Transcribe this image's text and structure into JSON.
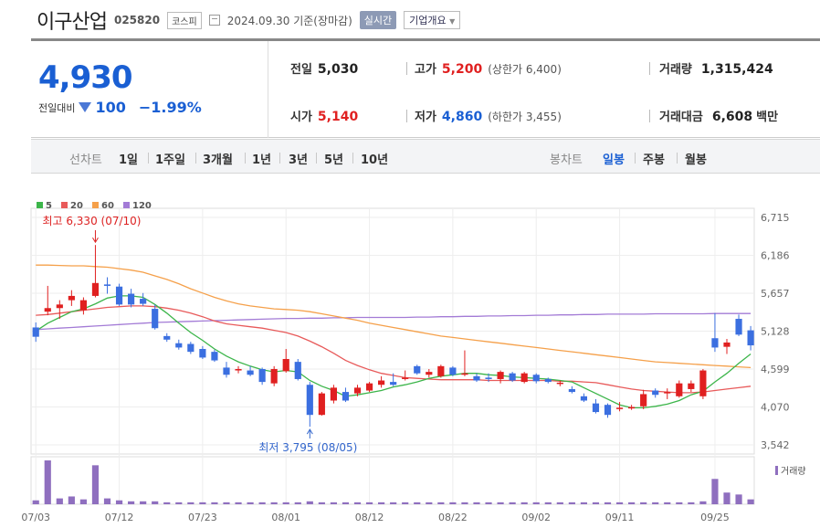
{
  "header": {
    "name": "이구산업",
    "code": "025820",
    "market": "코스피",
    "date": "2024.09.30 기준(장마감)",
    "realtime": "실시간",
    "company_info": "기업개요"
  },
  "price": {
    "current": "4,930",
    "change_label": "전일대비",
    "change": "100",
    "change_pct": "−1.99%"
  },
  "info": {
    "prev_close": {
      "label": "전일",
      "value": "5,030"
    },
    "open": {
      "label": "시가",
      "value": "5,140"
    },
    "high": {
      "label": "고가",
      "value": "5,200",
      "sub": "(상한가 6,400)"
    },
    "low": {
      "label": "저가",
      "value": "4,860",
      "sub": "(하한가 3,455)"
    },
    "volume": {
      "label": "거래량",
      "value": "1,315,424"
    },
    "amount": {
      "label": "거래대금",
      "value": "6,608",
      "unit": "백만"
    }
  },
  "periods": {
    "line_label": "선차트",
    "line_items": [
      "1일",
      "1주일",
      "3개월",
      "1년",
      "3년",
      "5년",
      "10년"
    ],
    "candle_label": "봉차트",
    "candle_items": [
      "일봉",
      "주봉",
      "월봉"
    ],
    "active_candle": "일봉"
  },
  "colors": {
    "up": "#e02020",
    "down": "#3b6fe0",
    "ma5": "#3cb54a",
    "ma20": "#e85a5a",
    "ma60": "#f5a04a",
    "ma120": "#a37bd6",
    "volume": "#8f6fbf"
  },
  "chart_data": {
    "type": "candlestick",
    "legend": [
      {
        "name": "5",
        "color": "#3cb54a"
      },
      {
        "name": "20",
        "color": "#e85a5a"
      },
      {
        "name": "60",
        "color": "#f5a04a"
      },
      {
        "name": "120",
        "color": "#a37bd6"
      }
    ],
    "y_ticks": [
      "6,715",
      "6,186",
      "5,657",
      "5,128",
      "4,599",
      "4,070",
      "3,542"
    ],
    "ylim": [
      3542,
      6715
    ],
    "x_tick_labels": [
      "07/03",
      "07/12",
      "07/23",
      "08/01",
      "08/12",
      "08/22",
      "09/02",
      "09/11",
      "09/25"
    ],
    "x_tick_index": [
      0,
      7,
      14,
      21,
      28,
      35,
      42,
      49,
      57
    ],
    "annotations": {
      "high": "최고 6,330 (07/10)",
      "high_index": 5,
      "high_value": 6330,
      "low": "최저 3,795 (08/05)",
      "low_index": 23,
      "low_value": 3795
    },
    "volume_label": "거래량",
    "candles": [
      {
        "o": 5180,
        "h": 5250,
        "l": 4980,
        "c": 5050
      },
      {
        "o": 5400,
        "h": 5760,
        "l": 5350,
        "c": 5450
      },
      {
        "o": 5450,
        "h": 5560,
        "l": 5300,
        "c": 5500
      },
      {
        "o": 5560,
        "h": 5700,
        "l": 5480,
        "c": 5620
      },
      {
        "o": 5420,
        "h": 5600,
        "l": 5360,
        "c": 5560
      },
      {
        "o": 5620,
        "h": 6330,
        "l": 5600,
        "c": 5800
      },
      {
        "o": 5780,
        "h": 5880,
        "l": 5650,
        "c": 5760
      },
      {
        "o": 5750,
        "h": 5790,
        "l": 5480,
        "c": 5500
      },
      {
        "o": 5650,
        "h": 5720,
        "l": 5460,
        "c": 5500
      },
      {
        "o": 5580,
        "h": 5660,
        "l": 5480,
        "c": 5510
      },
      {
        "o": 5440,
        "h": 5500,
        "l": 5150,
        "c": 5170
      },
      {
        "o": 5060,
        "h": 5100,
        "l": 4980,
        "c": 5010
      },
      {
        "o": 4960,
        "h": 5010,
        "l": 4870,
        "c": 4900
      },
      {
        "o": 4950,
        "h": 4980,
        "l": 4810,
        "c": 4840
      },
      {
        "o": 4880,
        "h": 4920,
        "l": 4740,
        "c": 4760
      },
      {
        "o": 4840,
        "h": 4870,
        "l": 4700,
        "c": 4720
      },
      {
        "o": 4620,
        "h": 4700,
        "l": 4480,
        "c": 4520
      },
      {
        "o": 4580,
        "h": 4640,
        "l": 4540,
        "c": 4600
      },
      {
        "o": 4580,
        "h": 4640,
        "l": 4500,
        "c": 4520
      },
      {
        "o": 4600,
        "h": 4620,
        "l": 4380,
        "c": 4420
      },
      {
        "o": 4400,
        "h": 4640,
        "l": 4360,
        "c": 4600
      },
      {
        "o": 4570,
        "h": 4880,
        "l": 4550,
        "c": 4740
      },
      {
        "o": 4700,
        "h": 4740,
        "l": 4440,
        "c": 4460
      },
      {
        "o": 4380,
        "h": 4420,
        "l": 3795,
        "c": 3960
      },
      {
        "o": 3960,
        "h": 4280,
        "l": 3950,
        "c": 4260
      },
      {
        "o": 4160,
        "h": 4380,
        "l": 4120,
        "c": 4340
      },
      {
        "o": 4280,
        "h": 4340,
        "l": 4140,
        "c": 4160
      },
      {
        "o": 4260,
        "h": 4380,
        "l": 4220,
        "c": 4340
      },
      {
        "o": 4300,
        "h": 4420,
        "l": 4280,
        "c": 4400
      },
      {
        "o": 4380,
        "h": 4500,
        "l": 4340,
        "c": 4440
      },
      {
        "o": 4420,
        "h": 4540,
        "l": 4360,
        "c": 4380
      },
      {
        "o": 4460,
        "h": 4580,
        "l": 4440,
        "c": 4480
      },
      {
        "o": 4640,
        "h": 4660,
        "l": 4520,
        "c": 4540
      },
      {
        "o": 4520,
        "h": 4600,
        "l": 4480,
        "c": 4560
      },
      {
        "o": 4500,
        "h": 4660,
        "l": 4480,
        "c": 4640
      },
      {
        "o": 4620,
        "h": 4640,
        "l": 4500,
        "c": 4520
      },
      {
        "o": 4520,
        "h": 4860,
        "l": 4500,
        "c": 4540
      },
      {
        "o": 4500,
        "h": 4540,
        "l": 4420,
        "c": 4440
      },
      {
        "o": 4480,
        "h": 4540,
        "l": 4420,
        "c": 4460
      },
      {
        "o": 4460,
        "h": 4580,
        "l": 4400,
        "c": 4560
      },
      {
        "o": 4540,
        "h": 4560,
        "l": 4420,
        "c": 4440
      },
      {
        "o": 4420,
        "h": 4560,
        "l": 4400,
        "c": 4540
      },
      {
        "o": 4520,
        "h": 4540,
        "l": 4400,
        "c": 4430
      },
      {
        "o": 4460,
        "h": 4480,
        "l": 4400,
        "c": 4420
      },
      {
        "o": 4400,
        "h": 4440,
        "l": 4360,
        "c": 4410
      },
      {
        "o": 4320,
        "h": 4360,
        "l": 4260,
        "c": 4280
      },
      {
        "o": 4220,
        "h": 4260,
        "l": 4140,
        "c": 4160
      },
      {
        "o": 4120,
        "h": 4180,
        "l": 3980,
        "c": 4000
      },
      {
        "o": 4100,
        "h": 4120,
        "l": 3920,
        "c": 3960
      },
      {
        "o": 4050,
        "h": 4140,
        "l": 4010,
        "c": 4060
      },
      {
        "o": 4050,
        "h": 4100,
        "l": 4030,
        "c": 4070
      },
      {
        "o": 4080,
        "h": 4310,
        "l": 4040,
        "c": 4250
      },
      {
        "o": 4300,
        "h": 4330,
        "l": 4200,
        "c": 4240
      },
      {
        "o": 4260,
        "h": 4330,
        "l": 4180,
        "c": 4280
      },
      {
        "o": 4220,
        "h": 4440,
        "l": 4200,
        "c": 4400
      },
      {
        "o": 4320,
        "h": 4440,
        "l": 4280,
        "c": 4400
      },
      {
        "o": 4220,
        "h": 4600,
        "l": 4180,
        "c": 4580
      },
      {
        "o": 5030,
        "h": 5380,
        "l": 4840,
        "c": 4900
      },
      {
        "o": 4910,
        "h": 5020,
        "l": 4810,
        "c": 4970
      },
      {
        "o": 5300,
        "h": 5360,
        "l": 5060,
        "c": 5080
      },
      {
        "o": 5140,
        "h": 5200,
        "l": 4860,
        "c": 4930
      }
    ],
    "ma5": [
      5130,
      5240,
      5320,
      5400,
      5440,
      5510,
      5590,
      5620,
      5620,
      5600,
      5500,
      5380,
      5240,
      5110,
      5000,
      4880,
      4780,
      4700,
      4640,
      4590,
      4560,
      4580,
      4560,
      4440,
      4360,
      4300,
      4220,
      4240,
      4270,
      4300,
      4350,
      4380,
      4420,
      4470,
      4500,
      4520,
      4540,
      4540,
      4520,
      4510,
      4490,
      4480,
      4470,
      4460,
      4440,
      4420,
      4340,
      4260,
      4180,
      4100,
      4060,
      4060,
      4080,
      4110,
      4160,
      4240,
      4290,
      4420,
      4540,
      4680,
      4810
    ],
    "ma20": [
      5350,
      5360,
      5380,
      5400,
      5420,
      5440,
      5460,
      5470,
      5480,
      5480,
      5470,
      5450,
      5420,
      5380,
      5330,
      5270,
      5230,
      5210,
      5190,
      5170,
      5140,
      5110,
      5060,
      4990,
      4910,
      4820,
      4720,
      4650,
      4590,
      4540,
      4510,
      4480,
      4470,
      4460,
      4450,
      4450,
      4450,
      4450,
      4440,
      4440,
      4440,
      4440,
      4440,
      4440,
      4430,
      4430,
      4420,
      4410,
      4380,
      4350,
      4320,
      4300,
      4290,
      4280,
      4270,
      4270,
      4280,
      4300,
      4320,
      4340,
      4360
    ],
    "ma60": [
      6050,
      6050,
      6045,
      6040,
      6040,
      6030,
      6020,
      6000,
      5980,
      5950,
      5900,
      5850,
      5790,
      5720,
      5660,
      5600,
      5550,
      5510,
      5480,
      5460,
      5440,
      5430,
      5420,
      5400,
      5370,
      5340,
      5310,
      5280,
      5240,
      5210,
      5180,
      5150,
      5120,
      5090,
      5060,
      5040,
      5020,
      5000,
      4980,
      4960,
      4940,
      4920,
      4900,
      4880,
      4860,
      4840,
      4820,
      4800,
      4780,
      4760,
      4740,
      4720,
      4700,
      4690,
      4680,
      4670,
      4660,
      4650,
      4640,
      4630,
      4620
    ],
    "ma120": [
      5150,
      5160,
      5170,
      5180,
      5190,
      5200,
      5210,
      5220,
      5230,
      5240,
      5250,
      5255,
      5260,
      5265,
      5270,
      5275,
      5280,
      5285,
      5290,
      5295,
      5300,
      5305,
      5305,
      5310,
      5310,
      5315,
      5315,
      5320,
      5320,
      5320,
      5320,
      5320,
      5325,
      5325,
      5330,
      5330,
      5335,
      5335,
      5340,
      5340,
      5345,
      5345,
      5350,
      5350,
      5355,
      5355,
      5360,
      5360,
      5365,
      5365,
      5365,
      5365,
      5370,
      5370,
      5370,
      5370,
      5370,
      5375,
      5375,
      5375,
      5375
    ],
    "volume": [
      4,
      45,
      6,
      8,
      5,
      40,
      6,
      4,
      3,
      3,
      3,
      2,
      2,
      2,
      2,
      2,
      2,
      2,
      2,
      2,
      2,
      2,
      2,
      3,
      2,
      2,
      2,
      2,
      2,
      2,
      2,
      2,
      2,
      2,
      2,
      2,
      2,
      2,
      2,
      2,
      2,
      2,
      2,
      2,
      2,
      2,
      2,
      2,
      2,
      2,
      2,
      2,
      2,
      2,
      2,
      2,
      3,
      26,
      12,
      10,
      5
    ]
  }
}
